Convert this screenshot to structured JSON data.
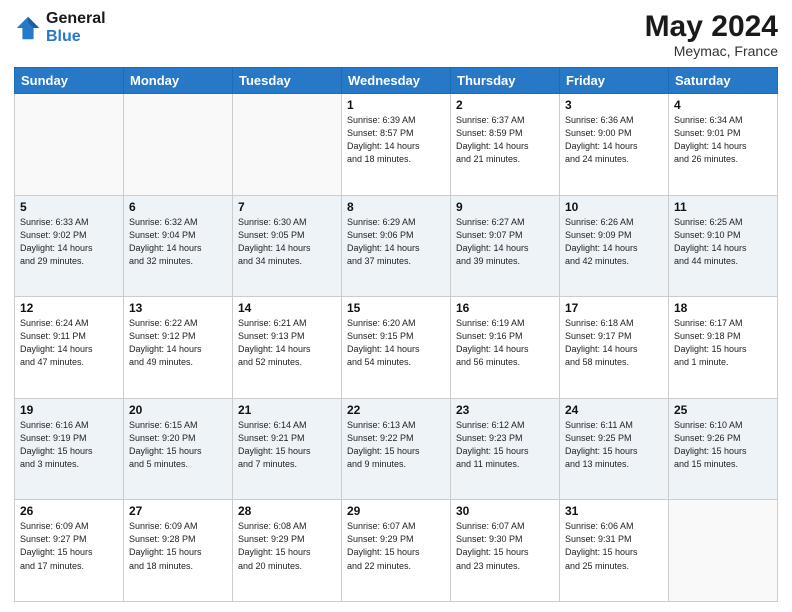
{
  "header": {
    "logo_line1": "General",
    "logo_line2": "Blue",
    "month_title": "May 2024",
    "location": "Meymac, France"
  },
  "weekdays": [
    "Sunday",
    "Monday",
    "Tuesday",
    "Wednesday",
    "Thursday",
    "Friday",
    "Saturday"
  ],
  "weeks": [
    [
      {
        "day": "",
        "info": ""
      },
      {
        "day": "",
        "info": ""
      },
      {
        "day": "",
        "info": ""
      },
      {
        "day": "1",
        "info": "Sunrise: 6:39 AM\nSunset: 8:57 PM\nDaylight: 14 hours\nand 18 minutes."
      },
      {
        "day": "2",
        "info": "Sunrise: 6:37 AM\nSunset: 8:59 PM\nDaylight: 14 hours\nand 21 minutes."
      },
      {
        "day": "3",
        "info": "Sunrise: 6:36 AM\nSunset: 9:00 PM\nDaylight: 14 hours\nand 24 minutes."
      },
      {
        "day": "4",
        "info": "Sunrise: 6:34 AM\nSunset: 9:01 PM\nDaylight: 14 hours\nand 26 minutes."
      }
    ],
    [
      {
        "day": "5",
        "info": "Sunrise: 6:33 AM\nSunset: 9:02 PM\nDaylight: 14 hours\nand 29 minutes."
      },
      {
        "day": "6",
        "info": "Sunrise: 6:32 AM\nSunset: 9:04 PM\nDaylight: 14 hours\nand 32 minutes."
      },
      {
        "day": "7",
        "info": "Sunrise: 6:30 AM\nSunset: 9:05 PM\nDaylight: 14 hours\nand 34 minutes."
      },
      {
        "day": "8",
        "info": "Sunrise: 6:29 AM\nSunset: 9:06 PM\nDaylight: 14 hours\nand 37 minutes."
      },
      {
        "day": "9",
        "info": "Sunrise: 6:27 AM\nSunset: 9:07 PM\nDaylight: 14 hours\nand 39 minutes."
      },
      {
        "day": "10",
        "info": "Sunrise: 6:26 AM\nSunset: 9:09 PM\nDaylight: 14 hours\nand 42 minutes."
      },
      {
        "day": "11",
        "info": "Sunrise: 6:25 AM\nSunset: 9:10 PM\nDaylight: 14 hours\nand 44 minutes."
      }
    ],
    [
      {
        "day": "12",
        "info": "Sunrise: 6:24 AM\nSunset: 9:11 PM\nDaylight: 14 hours\nand 47 minutes."
      },
      {
        "day": "13",
        "info": "Sunrise: 6:22 AM\nSunset: 9:12 PM\nDaylight: 14 hours\nand 49 minutes."
      },
      {
        "day": "14",
        "info": "Sunrise: 6:21 AM\nSunset: 9:13 PM\nDaylight: 14 hours\nand 52 minutes."
      },
      {
        "day": "15",
        "info": "Sunrise: 6:20 AM\nSunset: 9:15 PM\nDaylight: 14 hours\nand 54 minutes."
      },
      {
        "day": "16",
        "info": "Sunrise: 6:19 AM\nSunset: 9:16 PM\nDaylight: 14 hours\nand 56 minutes."
      },
      {
        "day": "17",
        "info": "Sunrise: 6:18 AM\nSunset: 9:17 PM\nDaylight: 14 hours\nand 58 minutes."
      },
      {
        "day": "18",
        "info": "Sunrise: 6:17 AM\nSunset: 9:18 PM\nDaylight: 15 hours\nand 1 minute."
      }
    ],
    [
      {
        "day": "19",
        "info": "Sunrise: 6:16 AM\nSunset: 9:19 PM\nDaylight: 15 hours\nand 3 minutes."
      },
      {
        "day": "20",
        "info": "Sunrise: 6:15 AM\nSunset: 9:20 PM\nDaylight: 15 hours\nand 5 minutes."
      },
      {
        "day": "21",
        "info": "Sunrise: 6:14 AM\nSunset: 9:21 PM\nDaylight: 15 hours\nand 7 minutes."
      },
      {
        "day": "22",
        "info": "Sunrise: 6:13 AM\nSunset: 9:22 PM\nDaylight: 15 hours\nand 9 minutes."
      },
      {
        "day": "23",
        "info": "Sunrise: 6:12 AM\nSunset: 9:23 PM\nDaylight: 15 hours\nand 11 minutes."
      },
      {
        "day": "24",
        "info": "Sunrise: 6:11 AM\nSunset: 9:25 PM\nDaylight: 15 hours\nand 13 minutes."
      },
      {
        "day": "25",
        "info": "Sunrise: 6:10 AM\nSunset: 9:26 PM\nDaylight: 15 hours\nand 15 minutes."
      }
    ],
    [
      {
        "day": "26",
        "info": "Sunrise: 6:09 AM\nSunset: 9:27 PM\nDaylight: 15 hours\nand 17 minutes."
      },
      {
        "day": "27",
        "info": "Sunrise: 6:09 AM\nSunset: 9:28 PM\nDaylight: 15 hours\nand 18 minutes."
      },
      {
        "day": "28",
        "info": "Sunrise: 6:08 AM\nSunset: 9:29 PM\nDaylight: 15 hours\nand 20 minutes."
      },
      {
        "day": "29",
        "info": "Sunrise: 6:07 AM\nSunset: 9:29 PM\nDaylight: 15 hours\nand 22 minutes."
      },
      {
        "day": "30",
        "info": "Sunrise: 6:07 AM\nSunset: 9:30 PM\nDaylight: 15 hours\nand 23 minutes."
      },
      {
        "day": "31",
        "info": "Sunrise: 6:06 AM\nSunset: 9:31 PM\nDaylight: 15 hours\nand 25 minutes."
      },
      {
        "day": "",
        "info": ""
      }
    ]
  ]
}
